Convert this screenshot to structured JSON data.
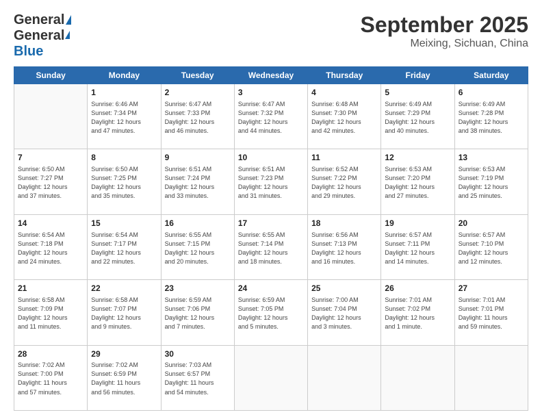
{
  "header": {
    "logo_general": "General",
    "logo_blue": "Blue",
    "title": "September 2025",
    "location": "Meixing, Sichuan, China"
  },
  "weekdays": [
    "Sunday",
    "Monday",
    "Tuesday",
    "Wednesday",
    "Thursday",
    "Friday",
    "Saturday"
  ],
  "weeks": [
    [
      {
        "day": "",
        "info": ""
      },
      {
        "day": "1",
        "info": "Sunrise: 6:46 AM\nSunset: 7:34 PM\nDaylight: 12 hours\nand 47 minutes."
      },
      {
        "day": "2",
        "info": "Sunrise: 6:47 AM\nSunset: 7:33 PM\nDaylight: 12 hours\nand 46 minutes."
      },
      {
        "day": "3",
        "info": "Sunrise: 6:47 AM\nSunset: 7:32 PM\nDaylight: 12 hours\nand 44 minutes."
      },
      {
        "day": "4",
        "info": "Sunrise: 6:48 AM\nSunset: 7:30 PM\nDaylight: 12 hours\nand 42 minutes."
      },
      {
        "day": "5",
        "info": "Sunrise: 6:49 AM\nSunset: 7:29 PM\nDaylight: 12 hours\nand 40 minutes."
      },
      {
        "day": "6",
        "info": "Sunrise: 6:49 AM\nSunset: 7:28 PM\nDaylight: 12 hours\nand 38 minutes."
      }
    ],
    [
      {
        "day": "7",
        "info": "Sunrise: 6:50 AM\nSunset: 7:27 PM\nDaylight: 12 hours\nand 37 minutes."
      },
      {
        "day": "8",
        "info": "Sunrise: 6:50 AM\nSunset: 7:25 PM\nDaylight: 12 hours\nand 35 minutes."
      },
      {
        "day": "9",
        "info": "Sunrise: 6:51 AM\nSunset: 7:24 PM\nDaylight: 12 hours\nand 33 minutes."
      },
      {
        "day": "10",
        "info": "Sunrise: 6:51 AM\nSunset: 7:23 PM\nDaylight: 12 hours\nand 31 minutes."
      },
      {
        "day": "11",
        "info": "Sunrise: 6:52 AM\nSunset: 7:22 PM\nDaylight: 12 hours\nand 29 minutes."
      },
      {
        "day": "12",
        "info": "Sunrise: 6:53 AM\nSunset: 7:20 PM\nDaylight: 12 hours\nand 27 minutes."
      },
      {
        "day": "13",
        "info": "Sunrise: 6:53 AM\nSunset: 7:19 PM\nDaylight: 12 hours\nand 25 minutes."
      }
    ],
    [
      {
        "day": "14",
        "info": "Sunrise: 6:54 AM\nSunset: 7:18 PM\nDaylight: 12 hours\nand 24 minutes."
      },
      {
        "day": "15",
        "info": "Sunrise: 6:54 AM\nSunset: 7:17 PM\nDaylight: 12 hours\nand 22 minutes."
      },
      {
        "day": "16",
        "info": "Sunrise: 6:55 AM\nSunset: 7:15 PM\nDaylight: 12 hours\nand 20 minutes."
      },
      {
        "day": "17",
        "info": "Sunrise: 6:55 AM\nSunset: 7:14 PM\nDaylight: 12 hours\nand 18 minutes."
      },
      {
        "day": "18",
        "info": "Sunrise: 6:56 AM\nSunset: 7:13 PM\nDaylight: 12 hours\nand 16 minutes."
      },
      {
        "day": "19",
        "info": "Sunrise: 6:57 AM\nSunset: 7:11 PM\nDaylight: 12 hours\nand 14 minutes."
      },
      {
        "day": "20",
        "info": "Sunrise: 6:57 AM\nSunset: 7:10 PM\nDaylight: 12 hours\nand 12 minutes."
      }
    ],
    [
      {
        "day": "21",
        "info": "Sunrise: 6:58 AM\nSunset: 7:09 PM\nDaylight: 12 hours\nand 11 minutes."
      },
      {
        "day": "22",
        "info": "Sunrise: 6:58 AM\nSunset: 7:07 PM\nDaylight: 12 hours\nand 9 minutes."
      },
      {
        "day": "23",
        "info": "Sunrise: 6:59 AM\nSunset: 7:06 PM\nDaylight: 12 hours\nand 7 minutes."
      },
      {
        "day": "24",
        "info": "Sunrise: 6:59 AM\nSunset: 7:05 PM\nDaylight: 12 hours\nand 5 minutes."
      },
      {
        "day": "25",
        "info": "Sunrise: 7:00 AM\nSunset: 7:04 PM\nDaylight: 12 hours\nand 3 minutes."
      },
      {
        "day": "26",
        "info": "Sunrise: 7:01 AM\nSunset: 7:02 PM\nDaylight: 12 hours\nand 1 minute."
      },
      {
        "day": "27",
        "info": "Sunrise: 7:01 AM\nSunset: 7:01 PM\nDaylight: 11 hours\nand 59 minutes."
      }
    ],
    [
      {
        "day": "28",
        "info": "Sunrise: 7:02 AM\nSunset: 7:00 PM\nDaylight: 11 hours\nand 57 minutes."
      },
      {
        "day": "29",
        "info": "Sunrise: 7:02 AM\nSunset: 6:59 PM\nDaylight: 11 hours\nand 56 minutes."
      },
      {
        "day": "30",
        "info": "Sunrise: 7:03 AM\nSunset: 6:57 PM\nDaylight: 11 hours\nand 54 minutes."
      },
      {
        "day": "",
        "info": ""
      },
      {
        "day": "",
        "info": ""
      },
      {
        "day": "",
        "info": ""
      },
      {
        "day": "",
        "info": ""
      }
    ]
  ]
}
